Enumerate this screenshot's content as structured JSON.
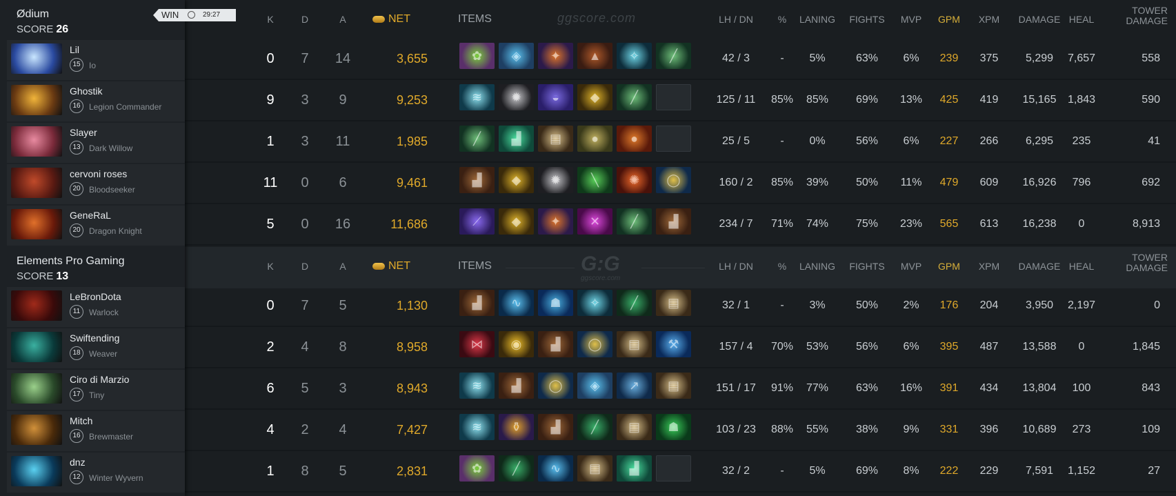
{
  "teams": [
    {
      "name": "Ødium",
      "score_label": "SCORE",
      "score": "26",
      "result": "WIN",
      "duration": "29:27",
      "players": [
        {
          "name": "Lil",
          "level": "15",
          "hero": "Io",
          "portrait": [
            "#2a4aa0",
            "#c9e6ff"
          ],
          "k": "0",
          "d": "7",
          "a": "14",
          "net": "3,655",
          "items": [
            {
              "icon": "mango-icon",
              "c": [
                "#5a2f6a",
                "#7bd13c"
              ]
            },
            {
              "icon": "crystal-icon",
              "c": [
                "#1e3f63",
                "#5cc3f0"
              ]
            },
            {
              "icon": "wand-icon",
              "c": [
                "#2c1a4a",
                "#e0762a"
              ]
            },
            {
              "icon": "cloak-icon",
              "c": [
                "#3a1c12",
                "#b05a2a"
              ]
            },
            {
              "icon": "spirit-icon",
              "c": [
                "#0d2c3a",
                "#6fd7e8"
              ]
            },
            {
              "icon": "staff-icon",
              "c": [
                "#123222",
                "#6fbf7a"
              ]
            }
          ],
          "lh_dn": "42 / 3",
          "pct": "-",
          "laning": "5%",
          "fights": "63%",
          "mvp": "6%",
          "gpm": "239",
          "xpm": "375",
          "damage": "5,299",
          "heal": "7,657",
          "tower": "558"
        },
        {
          "name": "Ghostik",
          "level": "16",
          "hero": "Legion Commander",
          "portrait": [
            "#6a3a12",
            "#f0b43a"
          ],
          "k": "9",
          "d": "3",
          "a": "9",
          "net": "9,253",
          "items": [
            {
              "icon": "blade-icon",
              "c": [
                "#0f3a4a",
                "#8ee2f0"
              ]
            },
            {
              "icon": "shield-icon",
              "c": [
                "#1e1e22",
                "#c8c8cc"
              ]
            },
            {
              "icon": "helm-icon",
              "c": [
                "#2a1e6a",
                "#7a6ae0"
              ]
            },
            {
              "icon": "mask-icon",
              "c": [
                "#3a2a0a",
                "#e0b42a"
              ]
            },
            {
              "icon": "staff-icon",
              "c": [
                "#123222",
                "#6fbf7a"
              ]
            },
            {
              "icon": "empty",
              "c": []
            }
          ],
          "lh_dn": "125 / 11",
          "pct": "85%",
          "laning": "85%",
          "fights": "69%",
          "mvp": "13%",
          "gpm": "425",
          "xpm": "419",
          "damage": "15,165",
          "heal": "1,843",
          "tower": "590"
        },
        {
          "name": "Slayer",
          "level": "13",
          "hero": "Dark Willow",
          "portrait": [
            "#7a2a3a",
            "#e88aa0"
          ],
          "k": "1",
          "d": "3",
          "a": "11",
          "net": "1,985",
          "items": [
            {
              "icon": "staff-icon",
              "c": [
                "#123222",
                "#6fbf7a"
              ]
            },
            {
              "icon": "boots-icon",
              "c": [
                "#0f4a3a",
                "#4ae0a0"
              ]
            },
            {
              "icon": "scroll-icon",
              "c": [
                "#3a2a18",
                "#d8c08a"
              ]
            },
            {
              "icon": "orb-icon",
              "c": [
                "#3a3a1a",
                "#c0b060"
              ]
            },
            {
              "icon": "orb-icon",
              "c": [
                "#5a1a0a",
                "#e07a2a"
              ]
            },
            {
              "icon": "empty",
              "c": []
            }
          ],
          "lh_dn": "25 / 5",
          "pct": "-",
          "laning": "0%",
          "fights": "56%",
          "mvp": "6%",
          "gpm": "227",
          "xpm": "266",
          "damage": "6,295",
          "heal": "235",
          "tower": "41"
        },
        {
          "name": "cervoni roses",
          "level": "20",
          "hero": "Bloodseeker",
          "portrait": [
            "#5a1a12",
            "#c04a2a"
          ],
          "k": "11",
          "d": "0",
          "a": "6",
          "net": "9,461",
          "items": [
            {
              "icon": "boots-icon",
              "c": [
                "#3a2012",
                "#a06a3a"
              ]
            },
            {
              "icon": "mask-icon",
              "c": [
                "#3a2a0a",
                "#e0b42a"
              ]
            },
            {
              "icon": "shield-icon",
              "c": [
                "#1e1e22",
                "#c8c8cc"
              ]
            },
            {
              "icon": "dagger-icon",
              "c": [
                "#0f3a1a",
                "#5ad05a"
              ]
            },
            {
              "icon": "fire-icon",
              "c": [
                "#4a120a",
                "#f06a2a"
              ]
            },
            {
              "icon": "ring-icon",
              "c": [
                "#0f2a4a",
                "#e0c04a"
              ]
            }
          ],
          "lh_dn": "160 / 2",
          "pct": "85%",
          "laning": "39%",
          "fights": "50%",
          "mvp": "11%",
          "gpm": "479",
          "xpm": "609",
          "damage": "16,926",
          "heal": "796",
          "tower": "692"
        },
        {
          "name": "GeneRaL",
          "level": "20",
          "hero": "Dragon Knight",
          "portrait": [
            "#6a1a0a",
            "#e0702a"
          ],
          "k": "5",
          "d": "0",
          "a": "16",
          "net": "11,686",
          "items": [
            {
              "icon": "sword-icon",
              "c": [
                "#2a1a5a",
                "#8a6af0"
              ]
            },
            {
              "icon": "mask-icon",
              "c": [
                "#3a2a0a",
                "#e0b42a"
              ]
            },
            {
              "icon": "wand-icon",
              "c": [
                "#2c1a4a",
                "#e0762a"
              ]
            },
            {
              "icon": "cross-icon",
              "c": [
                "#4a0a4a",
                "#e04ae0"
              ]
            },
            {
              "icon": "staff-icon",
              "c": [
                "#123222",
                "#6fbf7a"
              ]
            },
            {
              "icon": "boots-icon",
              "c": [
                "#3a2012",
                "#a06a3a"
              ]
            }
          ],
          "lh_dn": "234 / 7",
          "pct": "71%",
          "laning": "74%",
          "fights": "75%",
          "mvp": "23%",
          "gpm": "565",
          "xpm": "613",
          "damage": "16,238",
          "heal": "0",
          "tower": "8,913"
        }
      ]
    },
    {
      "name": "Elements Pro Gaming",
      "score_label": "SCORE",
      "score": "13",
      "players": [
        {
          "name": "LeBronDota",
          "level": "11",
          "hero": "Warlock",
          "portrait": [
            "#3a0a0a",
            "#a02a1a"
          ],
          "k": "0",
          "d": "7",
          "a": "5",
          "net": "1,130",
          "items": [
            {
              "icon": "boots-icon",
              "c": [
                "#3a2012",
                "#a06a3a"
              ]
            },
            {
              "icon": "wave-icon",
              "c": [
                "#0a2a4a",
                "#5ac0f0"
              ]
            },
            {
              "icon": "frog-icon",
              "c": [
                "#0a2a5a",
                "#4ab0e0"
              ]
            },
            {
              "icon": "spirit-icon",
              "c": [
                "#0d2c3a",
                "#6fd7e8"
              ]
            },
            {
              "icon": "staff-icon",
              "c": [
                "#0f2a1a",
                "#3ab06a"
              ]
            },
            {
              "icon": "scroll-icon",
              "c": [
                "#3a2a18",
                "#d8c08a"
              ]
            }
          ],
          "lh_dn": "32 / 1",
          "pct": "-",
          "laning": "3%",
          "fights": "50%",
          "mvp": "2%",
          "gpm": "176",
          "xpm": "204",
          "damage": "3,950",
          "heal": "2,197",
          "tower": "0"
        },
        {
          "name": "Swiftending",
          "level": "18",
          "hero": "Weaver",
          "portrait": [
            "#0a3a3a",
            "#3ab0a0"
          ],
          "k": "2",
          "d": "4",
          "a": "8",
          "net": "8,958",
          "items": [
            {
              "icon": "claw-icon",
              "c": [
                "#3a0a12",
                "#e03a4a"
              ]
            },
            {
              "icon": "vortex-icon",
              "c": [
                "#3a2a0a",
                "#f0c02a"
              ]
            },
            {
              "icon": "boots-icon",
              "c": [
                "#3a2012",
                "#a06a3a"
              ]
            },
            {
              "icon": "ring-icon",
              "c": [
                "#0f2a4a",
                "#e0c04a"
              ]
            },
            {
              "icon": "scroll-icon",
              "c": [
                "#3a2a18",
                "#d8c08a"
              ]
            },
            {
              "icon": "hammer-icon",
              "c": [
                "#0a2a5a",
                "#5ab0f0"
              ]
            }
          ],
          "lh_dn": "157 / 4",
          "pct": "70%",
          "laning": "53%",
          "fights": "56%",
          "mvp": "6%",
          "gpm": "395",
          "xpm": "487",
          "damage": "13,588",
          "heal": "0",
          "tower": "1,845"
        },
        {
          "name": "Ciro di Marzio",
          "level": "17",
          "hero": "Tiny",
          "portrait": [
            "#2a4a2a",
            "#9ad08a"
          ],
          "k": "6",
          "d": "5",
          "a": "3",
          "net": "8,943",
          "items": [
            {
              "icon": "blade-icon",
              "c": [
                "#0f3a4a",
                "#8ee2f0"
              ]
            },
            {
              "icon": "boots-icon",
              "c": [
                "#3a2012",
                "#a06a3a"
              ]
            },
            {
              "icon": "ring-icon",
              "c": [
                "#0f2a4a",
                "#e0c04a"
              ]
            },
            {
              "icon": "crystal-icon",
              "c": [
                "#1e3f63",
                "#5cc3f0"
              ]
            },
            {
              "icon": "spear-icon",
              "c": [
                "#0f2a4a",
                "#6ab0e0"
              ]
            },
            {
              "icon": "scroll-icon",
              "c": [
                "#3a2a18",
                "#d8c08a"
              ]
            }
          ],
          "lh_dn": "151 / 17",
          "pct": "91%",
          "laning": "77%",
          "fights": "63%",
          "mvp": "16%",
          "gpm": "391",
          "xpm": "434",
          "damage": "13,804",
          "heal": "100",
          "tower": "843"
        },
        {
          "name": "Mitch",
          "level": "16",
          "hero": "Brewmaster",
          "portrait": [
            "#4a2a0a",
            "#d0903a"
          ],
          "k": "4",
          "d": "2",
          "a": "4",
          "net": "7,427",
          "items": [
            {
              "icon": "blade-icon",
              "c": [
                "#0f3a4a",
                "#8ee2f0"
              ]
            },
            {
              "icon": "flask-icon",
              "c": [
                "#2a1a4a",
                "#e0a02a"
              ]
            },
            {
              "icon": "boots-icon",
              "c": [
                "#3a2012",
                "#a06a3a"
              ]
            },
            {
              "icon": "staff-icon",
              "c": [
                "#0f2a1a",
                "#3ab06a"
              ]
            },
            {
              "icon": "scroll-icon",
              "c": [
                "#3a2a18",
                "#d8c08a"
              ]
            },
            {
              "icon": "hood-icon",
              "c": [
                "#0a3a1a",
                "#3ad05a"
              ]
            }
          ],
          "lh_dn": "103 / 23",
          "pct": "88%",
          "laning": "55%",
          "fights": "38%",
          "mvp": "9%",
          "gpm": "331",
          "xpm": "396",
          "damage": "10,689",
          "heal": "273",
          "tower": "109"
        },
        {
          "name": "dnz",
          "level": "12",
          "hero": "Winter Wyvern",
          "portrait": [
            "#0a3a5a",
            "#5ad0f0"
          ],
          "k": "1",
          "d": "8",
          "a": "5",
          "net": "2,831",
          "items": [
            {
              "icon": "mango-icon",
              "c": [
                "#5a2f6a",
                "#7bd13c"
              ]
            },
            {
              "icon": "staff-icon",
              "c": [
                "#0f2a1a",
                "#3ab06a"
              ]
            },
            {
              "icon": "wave-icon",
              "c": [
                "#0a2a4a",
                "#5ac0f0"
              ]
            },
            {
              "icon": "scroll-icon",
              "c": [
                "#3a2a18",
                "#d8c08a"
              ]
            },
            {
              "icon": "boots-icon",
              "c": [
                "#0f4a3a",
                "#4ae0a0"
              ]
            },
            {
              "icon": "empty",
              "c": []
            }
          ],
          "lh_dn": "32 / 2",
          "pct": "-",
          "laning": "5%",
          "fights": "69%",
          "mvp": "8%",
          "gpm": "222",
          "xpm": "229",
          "damage": "7,591",
          "heal": "1,152",
          "tower": "27"
        }
      ]
    }
  ],
  "columns": {
    "k": "K",
    "d": "D",
    "a": "A",
    "net": "NET",
    "items": "ITEMS",
    "lh_dn": "LH / DN",
    "pct": "%",
    "laning": "LANING",
    "fights": "FIGHTS",
    "mvp": "MVP",
    "gpm": "GPM",
    "xpm": "XPM",
    "damage": "DAMAGE",
    "heal": "HEAL",
    "tower_1": "TOWER",
    "tower_2": "DAMAGE"
  },
  "watermark": {
    "text": "ggscore.com",
    "logo": "G:G",
    "logo_sub": "ggscore.com"
  },
  "colors": {
    "gold": "#e0a92a",
    "gpm_header": "#d8b03a",
    "background": "#1a1e21",
    "sidebar": "#1d2125"
  }
}
